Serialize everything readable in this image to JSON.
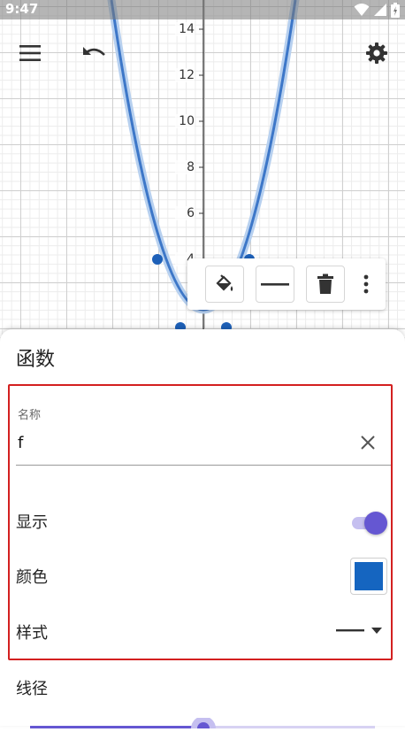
{
  "status_bar": {
    "time": "9:47"
  },
  "graph": {
    "y_ticks": [
      "14",
      "12",
      "10",
      "8",
      "6",
      "4"
    ],
    "curve_color": "#3d77c8",
    "point_color": "#1d60b8"
  },
  "top_bar": {
    "menu_icon": "menu-icon",
    "undo_icon": "undo-icon",
    "settings_icon": "gear-icon"
  },
  "toolbar": {
    "items": [
      "paint-bucket-icon",
      "line-style-icon",
      "trash-icon",
      "more-vert-icon"
    ]
  },
  "sheet": {
    "title": "函数",
    "name_label": "名称",
    "name_value": "f",
    "show_label": "显示",
    "show_on": true,
    "color_label": "颜色",
    "color_value": "#1565c0",
    "style_label": "样式",
    "line_width_label": "线径",
    "accent": "#6557d2",
    "highlight_color": "#d32020"
  }
}
